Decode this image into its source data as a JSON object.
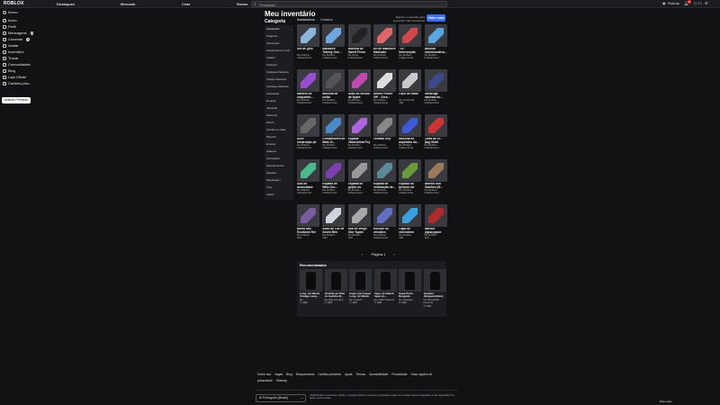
{
  "topbar": {
    "logo": "ROBLOX",
    "nav": [
      "Destaques",
      "Mercado",
      "Criar",
      "Robux"
    ],
    "search_placeholder": "Pesquisar",
    "robux_amount": "Robux",
    "robux_suffix": "no",
    "notif_badge": "9"
  },
  "sidebar": {
    "items": [
      {
        "label": "Kereo",
        "badge": ""
      },
      {
        "label": "Início",
        "badge": ""
      },
      {
        "label": "Perfil",
        "badge": ""
      },
      {
        "label": "Mensagens",
        "badge": "1"
      },
      {
        "label": "Conectar",
        "badge": "3"
      },
      {
        "label": "Avatar",
        "badge": ""
      },
      {
        "label": "Inventário",
        "badge": ""
      },
      {
        "label": "Trocar",
        "badge": ""
      },
      {
        "label": "Comunidades",
        "badge": ""
      },
      {
        "label": "Blog",
        "badge": ""
      },
      {
        "label": "Loja Oficial",
        "badge": ""
      },
      {
        "label": "Cartões-pres...",
        "badge": ""
      }
    ],
    "premium_button": "Assinar Premium"
  },
  "page": {
    "title": "Meu inventário",
    "tabs": [
      "Acessórios",
      "Criados"
    ],
    "help_text": "Explore o mercado para encontrar mais Acessórios",
    "get_more": "Obter mais",
    "category_title": "Categoria"
  },
  "categories": [
    "Acessórios",
    "Chapéus",
    "Acessórios",
    "Acessórios de rosto",
    "Cabelo",
    "Cabeças",
    "Cabeças clássicas",
    "Calças clássicas",
    "Camisas clássicas",
    "Camisetas",
    "Roupas",
    "Jaquetas",
    "Suéteres",
    "Shorts",
    "Vestidos e saias",
    "Pacotes",
    "Emotes",
    "Ataques",
    "Animações",
    "Equipamentos",
    "Sapatos",
    "Maquiagem",
    "Tops",
    "Ações"
  ],
  "items": [
    {
      "name": "Set de gelo",
      "creator": "De Roblox",
      "status": "Indisponível"
    },
    {
      "name": "Bandeira Twenty One...",
      "creator": "De Roblox",
      "status": "Indisponível"
    },
    {
      "name": "Mochila de Sweet Press",
      "creator": "De Pope",
      "status": "Indisponível"
    },
    {
      "name": "Kit de Manicure Machado",
      "creator": "De Roblox",
      "status": "Indisponível"
    },
    {
      "name": "\"LV\" Intervenção",
      "creator": "De Roblox",
      "status": "Indisponível"
    },
    {
      "name": "Mochila comemorativa...",
      "creator": "De Roblox",
      "status": "Indisponível"
    },
    {
      "name": "Martelo de esqueleto...",
      "creator": "De Roblox",
      "status": "Indisponível"
    },
    {
      "name": "Mochila de união",
      "creator": "De Roblox",
      "status": "Indisponível"
    },
    {
      "name": "Asas do século da Spark",
      "creator": "De Roblox",
      "status": "Indisponível"
    },
    {
      "name": "Álbum Poster VIP - Cera...",
      "creator": "De Roblox",
      "status": "Indisponível"
    },
    {
      "name": "Laço de Natal",
      "creator": "De Lurlinund",
      "status": "100"
    },
    {
      "name": "Tartaruga marinha do...",
      "creator": "De Roblox",
      "status": "Indisponível"
    },
    {
      "name": "Arco encarnado de luminação A...",
      "creator": "De Roblox",
      "status": "Indisponível"
    },
    {
      "name": "Cristalesfera do Mais Vi...",
      "creator": "De Roblox",
      "status": "Indisponível"
    },
    {
      "name": "Espada Ultravioleta Fey",
      "creator": "De Roblox",
      "status": "Indisponível"
    },
    {
      "name": "Teclado Key",
      "creator": "De Roblox",
      "status": "Indisponível"
    },
    {
      "name": "Mochila de aspirador da...",
      "creator": "De Roblox",
      "status": "Indisponível"
    },
    {
      "name": "Carta de 10 - Bag Giant Bea...",
      "creator": "De Roblox",
      "status": "Indisponível"
    },
    {
      "name": "Asa do anunciador",
      "creator": "De Roblox",
      "status": "Indisponível"
    },
    {
      "name": "Espada de Wild-Oct...",
      "creator": "De Roblox",
      "status": "Indisponível"
    },
    {
      "name": "Espada do cutelo do Salome",
      "creator": "De Roblox",
      "status": "Indisponível"
    },
    {
      "name": "Espada de vindicação de...",
      "creator": "De Roblox",
      "status": "Indisponível"
    },
    {
      "name": "Espada do tesouro da Dig...",
      "creator": "De Roblox",
      "status": "Indisponível"
    },
    {
      "name": "Martelo dos Galeões (M...",
      "creator": "De Roblox",
      "status": "Indisponível"
    },
    {
      "name": "Bolsa dos Ecoíanos Rei",
      "creator": "De Roblox",
      "status": "100"
    },
    {
      "name": "Asas de Luz de Seven Bite",
      "creator": "De Roblox",
      "status": "100"
    },
    {
      "name": "Asa de Verge-Dior Taped",
      "creator": "De Roblox",
      "status": "100"
    },
    {
      "name": "Escudo do vendeiro",
      "creator": "De Roblox",
      "status": "Indisponível"
    },
    {
      "name": "Capa de emendeiro",
      "creator": "De Roblox",
      "status": "100"
    },
    {
      "name": "Martelo espaçonave Super Sha...",
      "creator": "De Roblox",
      "status": "100"
    }
  ],
  "pager": {
    "prev": "‹",
    "label": "Página 1",
    "next": "›"
  },
  "recommended": {
    "title": "Recomendados",
    "items": [
      {
        "name": "Long_Art Black Vintage Lang...",
        "creator": "De ...",
        "price": "100"
      },
      {
        "name": "Mochila de Pele de Galinha M...",
        "creator": "De Ellg Dreams",
        "price": "100"
      },
      {
        "name": "Capa com Capuz Long, Art Black",
        "creator": "De LuaKK!",
        "price": "100"
      },
      {
        "name": "Capa, Art Black Capa do...",
        "creator": "De 1000 Dreams",
        "price": "100"
      },
      {
        "name": "Capa Preta Rasgada",
        "creator": "De Queldes",
        "price": "100"
      },
      {
        "name": "Sweater Mangada Black Scena...",
        "creator": "De Nissa000 Dreams",
        "price": "100"
      }
    ]
  },
  "footer": {
    "links": [
      "Sobre nós",
      "Vagas",
      "Blog",
      "Responsáveis",
      "Cartões-presente",
      "Ajuda",
      "Termos",
      "Acessibilidade",
      "Privacidade",
      "Suas opções de privacidade",
      "Sitemap"
    ],
    "language": "Português (Brasil)",
    "copyright": "©2025 Roblox Corporation. Roblox, o logotipo Roblox e Powering Imagination estão entre nossas marcas registradas e não registradas nos EUA e outros países.",
    "chat": "Bate-papo"
  }
}
